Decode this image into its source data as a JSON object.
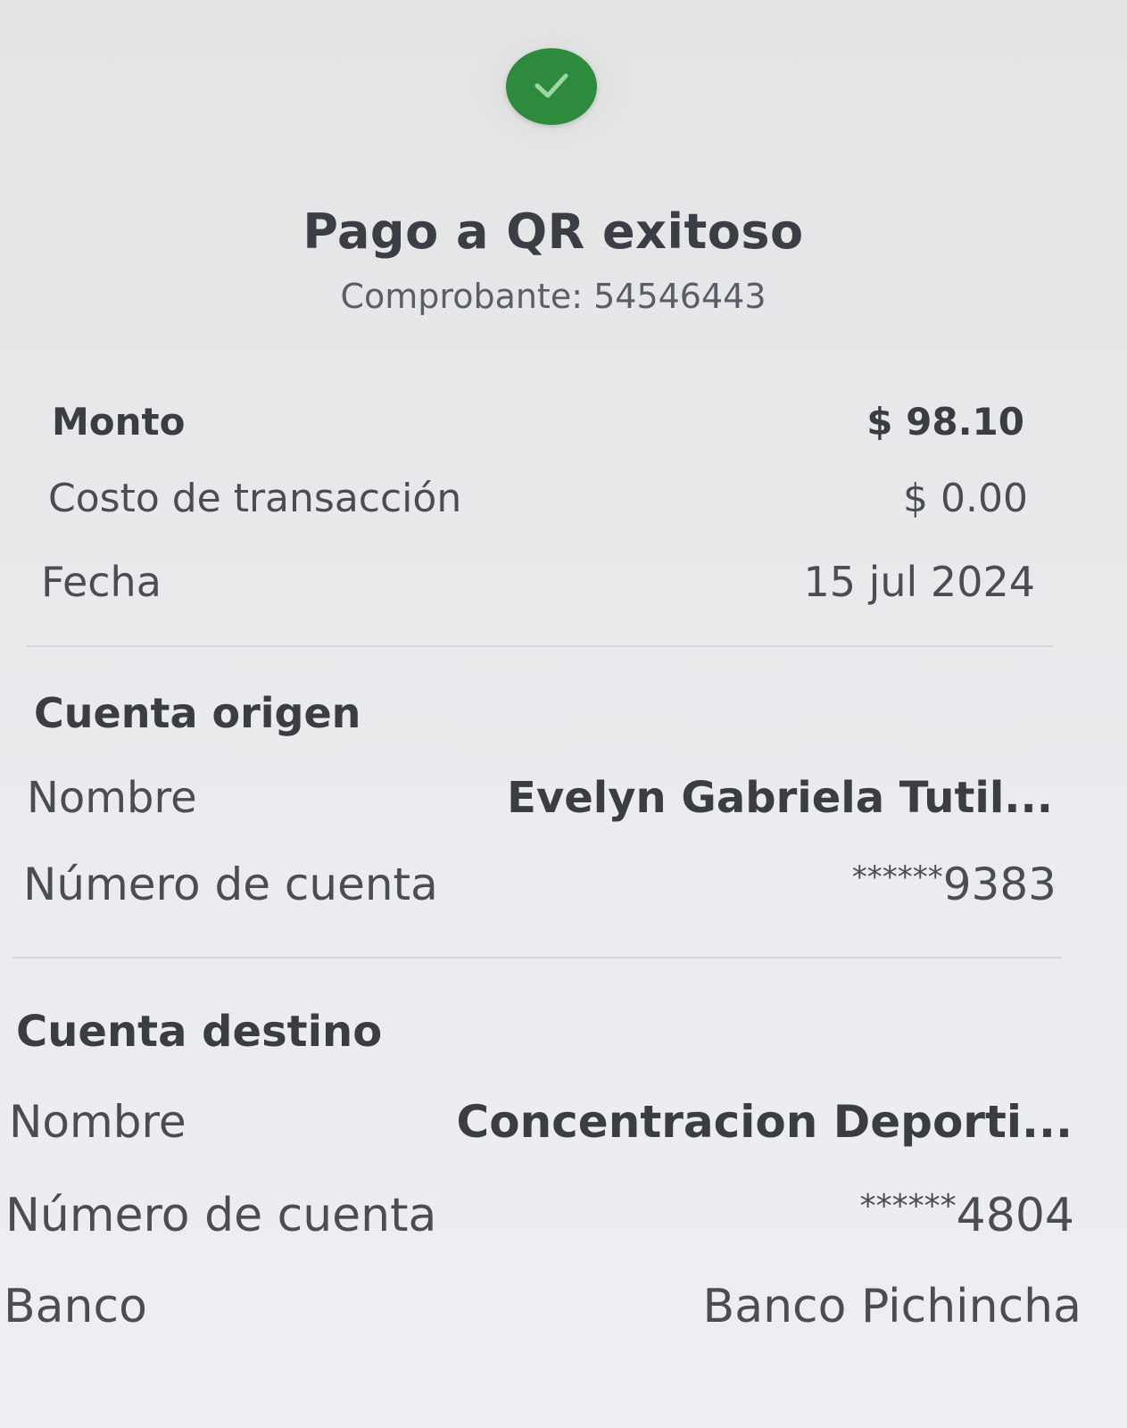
{
  "header": {
    "title": "Pago a QR exitoso",
    "receipt": "Comprobante: 54546443",
    "status_color": "#2e8b3e"
  },
  "summary": {
    "amount_label": "Monto",
    "amount_value": "$ 98.10",
    "fee_label": "Costo de transacción",
    "fee_value": "$ 0.00",
    "date_label": "Fecha",
    "date_value": "15 jul 2024"
  },
  "origin": {
    "section_title": "Cuenta origen",
    "name_label": "Nombre",
    "name_value": "Evelyn Gabriela Tutil...",
    "account_label": "Número de cuenta",
    "account_mask": "******",
    "account_last": "9383"
  },
  "destination": {
    "section_title": "Cuenta destino",
    "name_label": "Nombre",
    "name_value": "Concentracion Deporti...",
    "account_label": "Número de cuenta",
    "account_mask": "******",
    "account_last": "4804",
    "bank_label": "Banco",
    "bank_value": "Banco Pichincha"
  }
}
